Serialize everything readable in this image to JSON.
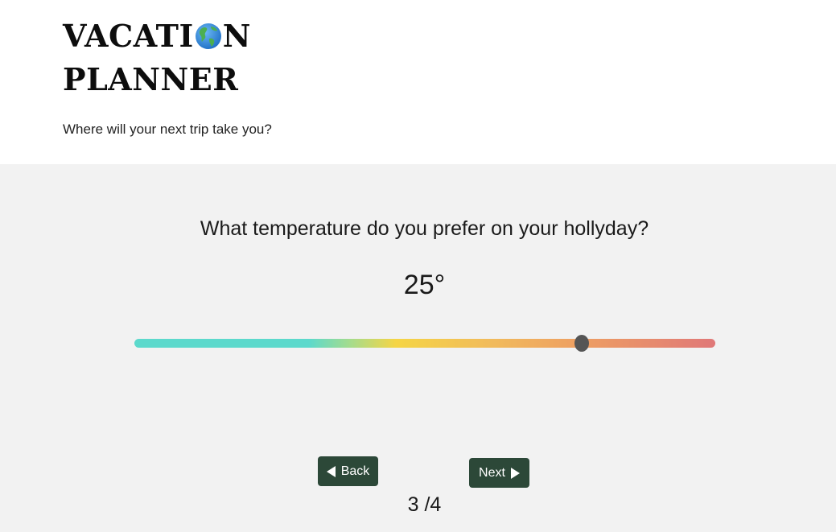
{
  "header": {
    "brand_line1_part1": "VACATI",
    "brand_icon": "globe-americas-icon",
    "brand_line1_part2": "N",
    "brand_line2": "PLANNER",
    "tagline": "Where will your next trip take you?"
  },
  "question": {
    "text": "What temperature do you prefer on your hollyday?",
    "temperature_value": "25°",
    "slider_position": 0.77
  },
  "navigation": {
    "back_label": "Back",
    "next_label": "Next",
    "back_icon": "triangle-left-icon",
    "next_icon": "triangle-right-icon"
  },
  "progress": {
    "text": "3 /4"
  },
  "colors": {
    "button_bg": "#2c4838",
    "main_bg": "#f2f2f2",
    "slider_thumb": "#555555",
    "slider_cool": "#5cd9cc",
    "slider_mid": "#f5d545",
    "slider_hot": "#e07878"
  }
}
